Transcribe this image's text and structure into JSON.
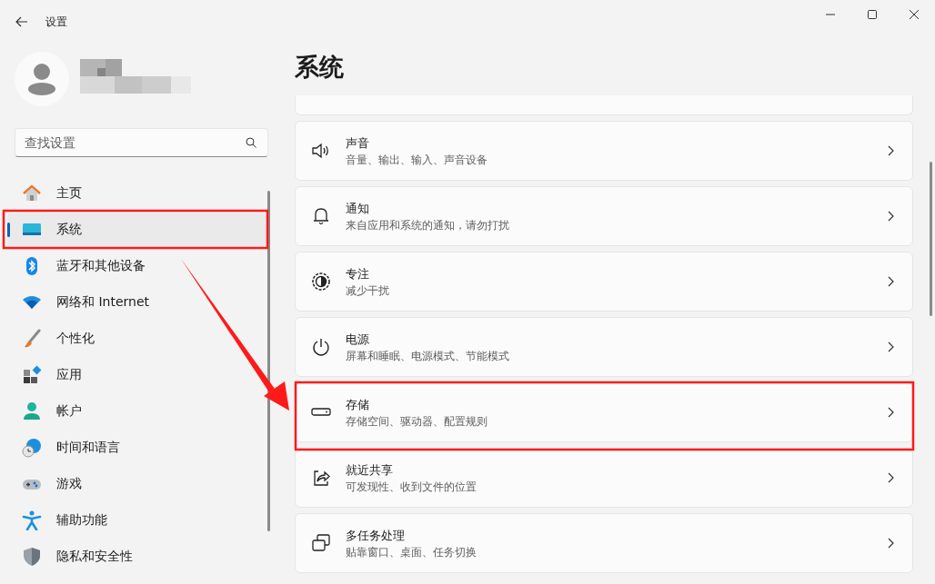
{
  "window": {
    "title": "设置"
  },
  "search": {
    "placeholder": "查找设置"
  },
  "sidebar": {
    "items": [
      {
        "label": "主页",
        "selected": false
      },
      {
        "label": "系统",
        "selected": true
      },
      {
        "label": "蓝牙和其他设备",
        "selected": false
      },
      {
        "label": "网络和 Internet",
        "selected": false
      },
      {
        "label": "个性化",
        "selected": false
      },
      {
        "label": "应用",
        "selected": false
      },
      {
        "label": "帐户",
        "selected": false
      },
      {
        "label": "时间和语言",
        "selected": false
      },
      {
        "label": "游戏",
        "selected": false
      },
      {
        "label": "辅助功能",
        "selected": false
      },
      {
        "label": "隐私和安全性",
        "selected": false
      }
    ]
  },
  "page_title": "系统",
  "settings": [
    {
      "title": "声音",
      "description": "音量、输出、输入、声音设备"
    },
    {
      "title": "通知",
      "description": "来自应用和系统的通知，请勿打扰"
    },
    {
      "title": "专注",
      "description": "减少干扰"
    },
    {
      "title": "电源",
      "description": "屏幕和睡眠、电源模式、节能模式"
    },
    {
      "title": "存储",
      "description": "存储空间、驱动器、配置规则"
    },
    {
      "title": "就近共享",
      "description": "可发现性、收到文件的位置"
    },
    {
      "title": "多任务处理",
      "description": "贴靠窗口、桌面、任务切换"
    }
  ]
}
